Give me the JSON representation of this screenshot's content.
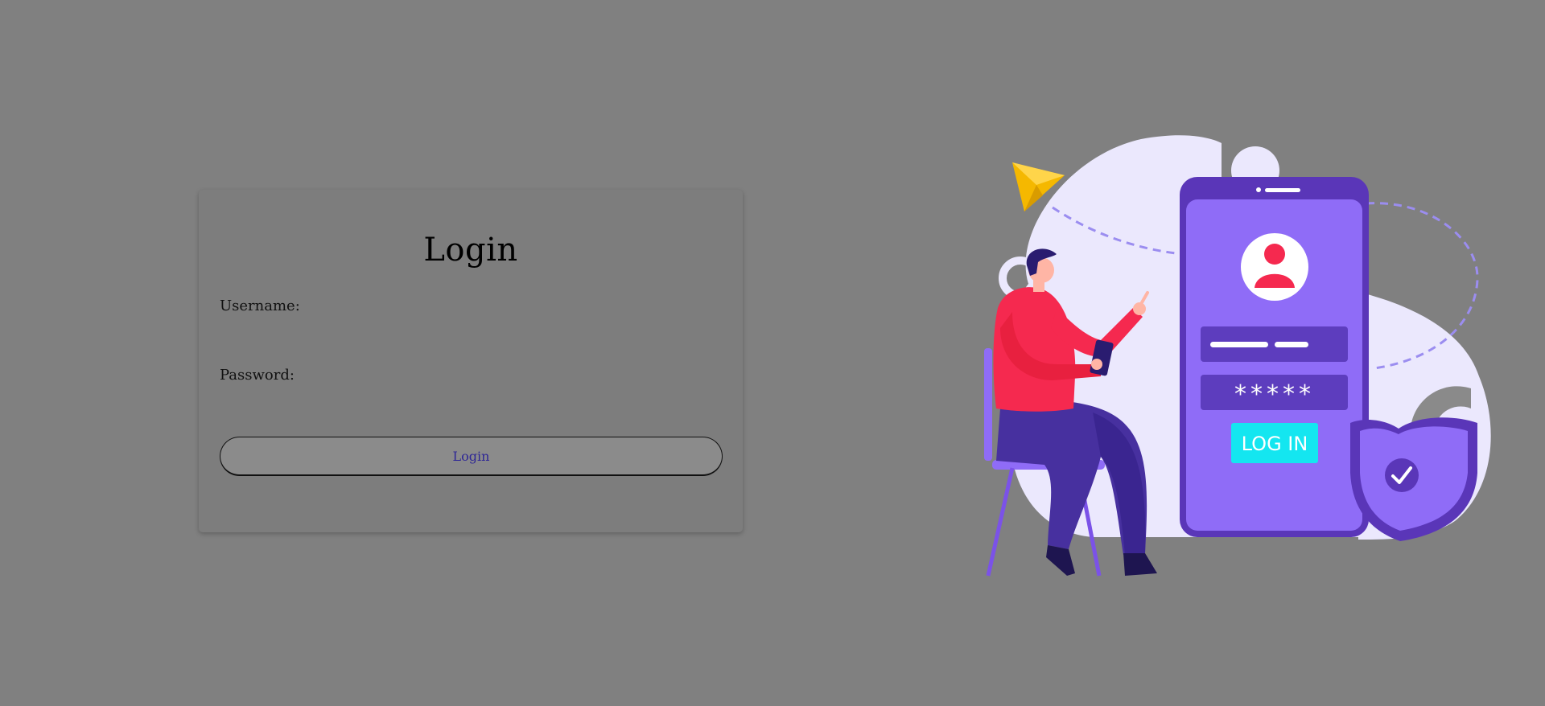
{
  "login": {
    "title": "Login",
    "username_label": "Username:",
    "username_value": "",
    "password_label": "Password:",
    "password_value": "",
    "button_label": "Login"
  },
  "illustration": {
    "password_mask": "*****",
    "button_text": "LOG IN"
  },
  "colors": {
    "background": "#808080",
    "card": "#7d7d7d",
    "button_text": "#2f2796",
    "phone": "#8f6cf7",
    "phone_dark": "#5a36b8",
    "accent_red": "#f5294f",
    "accent_cyan": "#14e6f0",
    "blob": "#ebe8fd",
    "paper_plane": "#f5b800"
  }
}
